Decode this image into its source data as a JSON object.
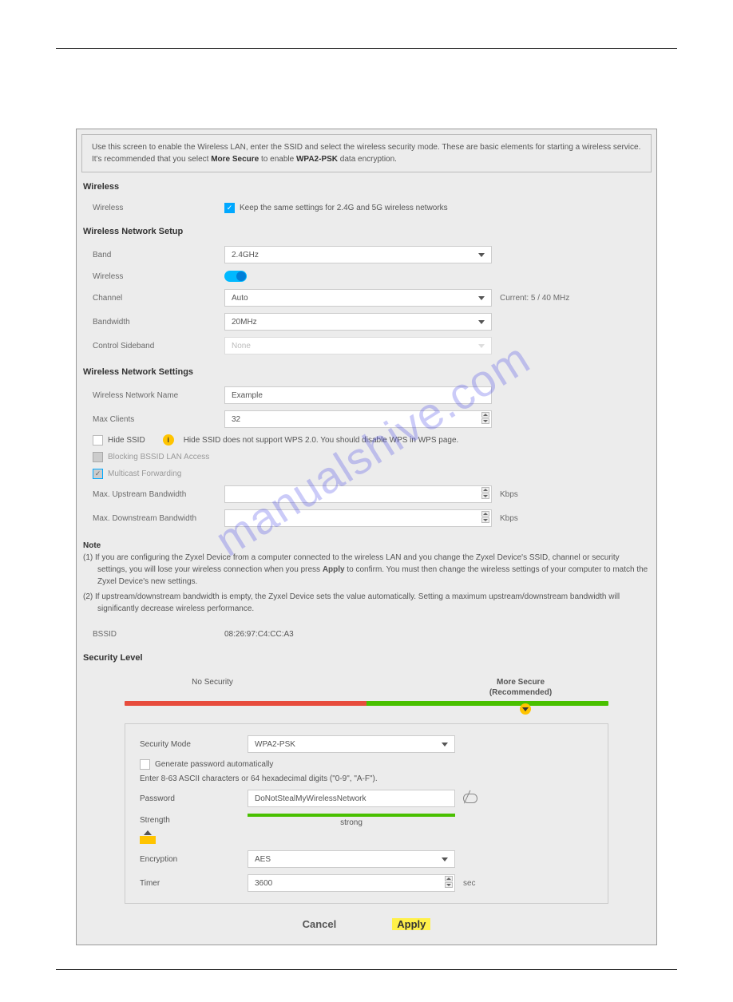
{
  "intro": {
    "text_a": "Use this screen to enable the Wireless LAN, enter the SSID and select the wireless security mode. These are basic elements for starting a wireless service. It's recommended that you select ",
    "bold_a": "More Secure",
    "text_b": " to enable ",
    "bold_b": "WPA2-PSK",
    "text_c": " data encryption."
  },
  "sections": {
    "wireless": "Wireless",
    "setup": "Wireless Network Setup",
    "settings": "Wireless Network Settings",
    "note": "Note",
    "security": "Security Level"
  },
  "wireless_top": {
    "label": "Wireless",
    "keep_same": "Keep the same settings for 2.4G and 5G wireless networks"
  },
  "setup": {
    "band_lbl": "Band",
    "band_val": "2.4GHz",
    "wireless_lbl": "Wireless",
    "channel_lbl": "Channel",
    "channel_val": "Auto",
    "channel_current": "Current: 5 / 40 MHz",
    "bandwidth_lbl": "Bandwidth",
    "bandwidth_val": "20MHz",
    "sideband_lbl": "Control Sideband",
    "sideband_val": "None"
  },
  "settings": {
    "name_lbl": "Wireless Network Name",
    "name_val": "Example",
    "max_clients_lbl": "Max Clients",
    "max_clients_val": "32",
    "hide_ssid_lbl": "Hide SSID",
    "hide_ssid_note": "Hide SSID does not support WPS 2.0. You should disable WPS in WPS page.",
    "blocking_lbl": "Blocking BSSID LAN Access",
    "multicast_lbl": "Multicast Forwarding",
    "max_up_lbl": "Max. Upstream Bandwidth",
    "max_dn_lbl": "Max. Downstream Bandwidth",
    "kbps": "Kbps"
  },
  "notes": {
    "n1a": "(1) If you are configuring the Zyxel Device from a computer connected to the wireless LAN and you change the Zyxel Device's SSID, channel or security settings, you will lose your wireless connection when you press ",
    "n1b": "Apply",
    "n1c": " to confirm. You must then change the wireless settings of your computer to match the Zyxel Device's new settings.",
    "n2": "(2) If upstream/downstream bandwidth is empty, the Zyxel Device sets the value automatically. Setting a maximum upstream/downstream bandwidth will significantly decrease wireless performance.",
    "bssid_lbl": "BSSID",
    "bssid_val": "08:26:97:C4:CC:A3"
  },
  "security": {
    "no_sec": "No Security",
    "more_secure": "More Secure",
    "recommended": "(Recommended)",
    "mode_lbl": "Security Mode",
    "mode_val": "WPA2-PSK",
    "gen_auto": "Generate password automatically",
    "pw_hint": "Enter 8-63 ASCII characters or 64 hexadecimal digits (\"0-9\", \"A-F\").",
    "pw_lbl": "Password",
    "pw_val": "DoNotStealMyWirelessNetwork",
    "strength_lbl": "Strength",
    "strength_val": "strong",
    "enc_lbl": "Encryption",
    "enc_val": "AES",
    "timer_lbl": "Timer",
    "timer_val": "3600",
    "timer_unit": "sec"
  },
  "buttons": {
    "cancel": "Cancel",
    "apply": "Apply"
  },
  "watermark": "manualshive.com"
}
